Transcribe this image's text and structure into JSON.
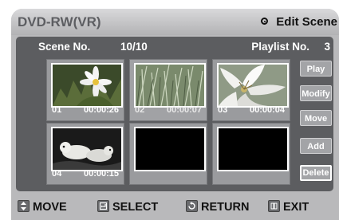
{
  "title": {
    "left": "DVD-RW(VR)",
    "right": "Edit Scene",
    "right_icon": "disc-icon"
  },
  "header": {
    "scene_label": "Scene No.",
    "scene_count": "10/10",
    "playlist_label": "Playlist No.",
    "playlist_number": "3"
  },
  "tiles": [
    {
      "index": "01",
      "timecode": "00:00:26",
      "thumbnail": "flower-icon"
    },
    {
      "index": "02",
      "timecode": "00:00:07",
      "thumbnail": "grass-icon",
      "selected": true
    },
    {
      "index": "03",
      "timecode": "00:00:04",
      "thumbnail": "lily-icon"
    },
    {
      "index": "04",
      "timecode": "00:00:15",
      "thumbnail": "otters-icon"
    },
    {
      "index": "",
      "timecode": "",
      "thumbnail": "blank"
    },
    {
      "index": "",
      "timecode": "",
      "thumbnail": "blank"
    }
  ],
  "buttons": [
    {
      "label": "Play"
    },
    {
      "label": "Modify"
    },
    {
      "label": "Move"
    },
    {
      "label": "Add"
    },
    {
      "label": "Delete",
      "active": true
    }
  ],
  "footer": {
    "move": {
      "label": "MOVE",
      "icon": "updown-arrow-icon"
    },
    "select": {
      "label": "SELECT",
      "icon": "enter-icon"
    },
    "return": {
      "label": "RETURN",
      "icon": "return-icon"
    },
    "exit": {
      "label": "EXIT",
      "icon": "menu-icon"
    }
  }
}
